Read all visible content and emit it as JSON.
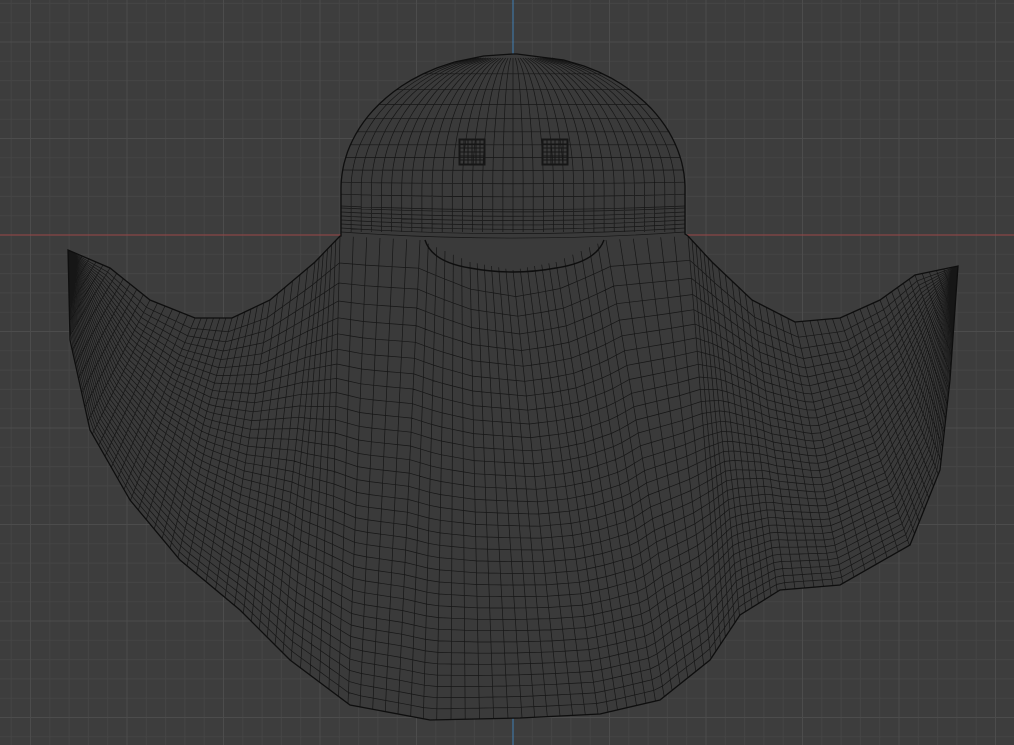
{
  "viewport": {
    "view": "front-orthographic",
    "display_mode": "wireframe",
    "object": "ghost-mesh",
    "grid": true,
    "axes": {
      "x_axis_color": "#9a4646",
      "z_axis_color": "#3f7fb5"
    },
    "colors": {
      "background": "#3d3d3d",
      "grid_minor": "#454545",
      "grid_major": "#4c4c4c",
      "mesh_fill": "#3a3a3a",
      "wire": "#161616",
      "outline": "#0e0e0e"
    }
  }
}
